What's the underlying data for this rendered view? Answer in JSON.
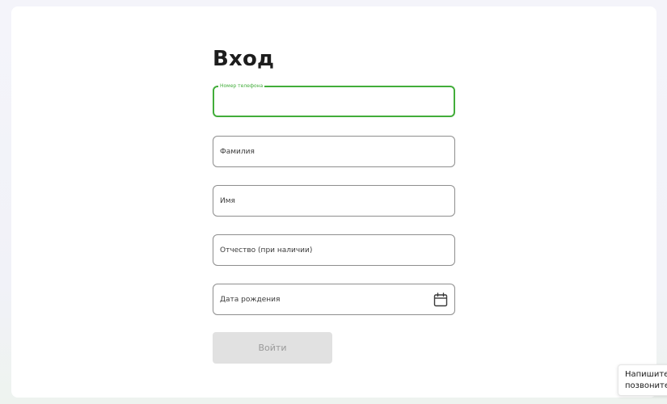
{
  "login": {
    "title": "Вход",
    "fields": {
      "phone": {
        "label": "Номер телефона",
        "value": ""
      },
      "last_name": {
        "placeholder": "Фамилия"
      },
      "first_name": {
        "placeholder": "Имя"
      },
      "middle_name": {
        "placeholder": "Отчество (при наличии)"
      },
      "birth_date": {
        "placeholder": "Дата рождения",
        "icon": "calendar-icon"
      }
    },
    "submit_label": "Войти"
  },
  "chat_widget": {
    "line1": "Напишите",
    "line2": "позвоните"
  },
  "colors": {
    "accent": "#42ad3a",
    "field_border": "#8e8e8e",
    "button_disabled_bg": "#e1e1e1",
    "button_disabled_text": "#9a9a9a",
    "title": "#1d1d1d"
  }
}
